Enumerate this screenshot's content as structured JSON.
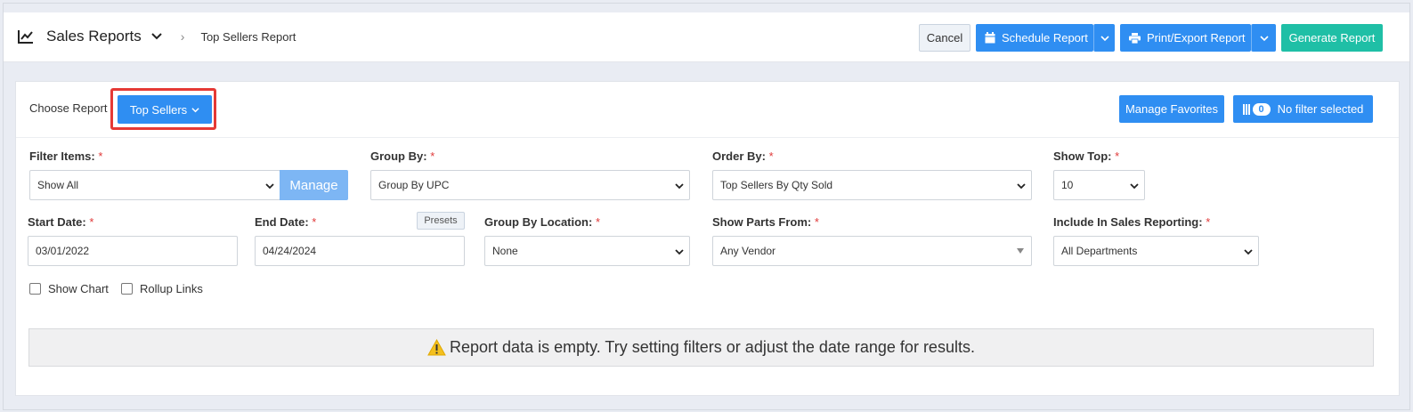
{
  "header": {
    "app_title": "Sales Reports",
    "breadcrumb": "Top Sellers Report",
    "buttons": {
      "cancel": "Cancel",
      "schedule": "Schedule Report",
      "print_export": "Print/Export Report",
      "generate": "Generate Report"
    }
  },
  "report": {
    "choose_label": "Choose Report",
    "selected": "Top Sellers",
    "manage_favorites": "Manage Favorites",
    "filter_count": "0",
    "filter_status": "No filter selected"
  },
  "filters": {
    "filter_items": {
      "label": "Filter Items:",
      "value": "Show All",
      "manage": "Manage"
    },
    "group_by": {
      "label": "Group By:",
      "value": "Group By UPC"
    },
    "order_by": {
      "label": "Order By:",
      "value": "Top Sellers By Qty Sold"
    },
    "show_top": {
      "label": "Show Top:",
      "value": "10"
    },
    "start_date": {
      "label": "Start Date:",
      "value": "03/01/2022"
    },
    "end_date": {
      "label": "End Date:",
      "value": "04/24/2024",
      "presets": "Presets"
    },
    "group_by_location": {
      "label": "Group By Location:",
      "value": "None"
    },
    "show_parts_from": {
      "label": "Show Parts From:",
      "value": "Any Vendor"
    },
    "include_in_sales": {
      "label": "Include In Sales Reporting:",
      "value": "All Departments"
    },
    "required_marker": "*"
  },
  "options": {
    "show_chart": "Show Chart",
    "rollup_links": "Rollup Links"
  },
  "message": "Report data is empty. Try setting filters or adjust the date range for results.",
  "colors": {
    "primary": "#2f8ef2",
    "teal": "#1fbfa6",
    "required": "#e03a3a",
    "highlight": "#e53935"
  }
}
